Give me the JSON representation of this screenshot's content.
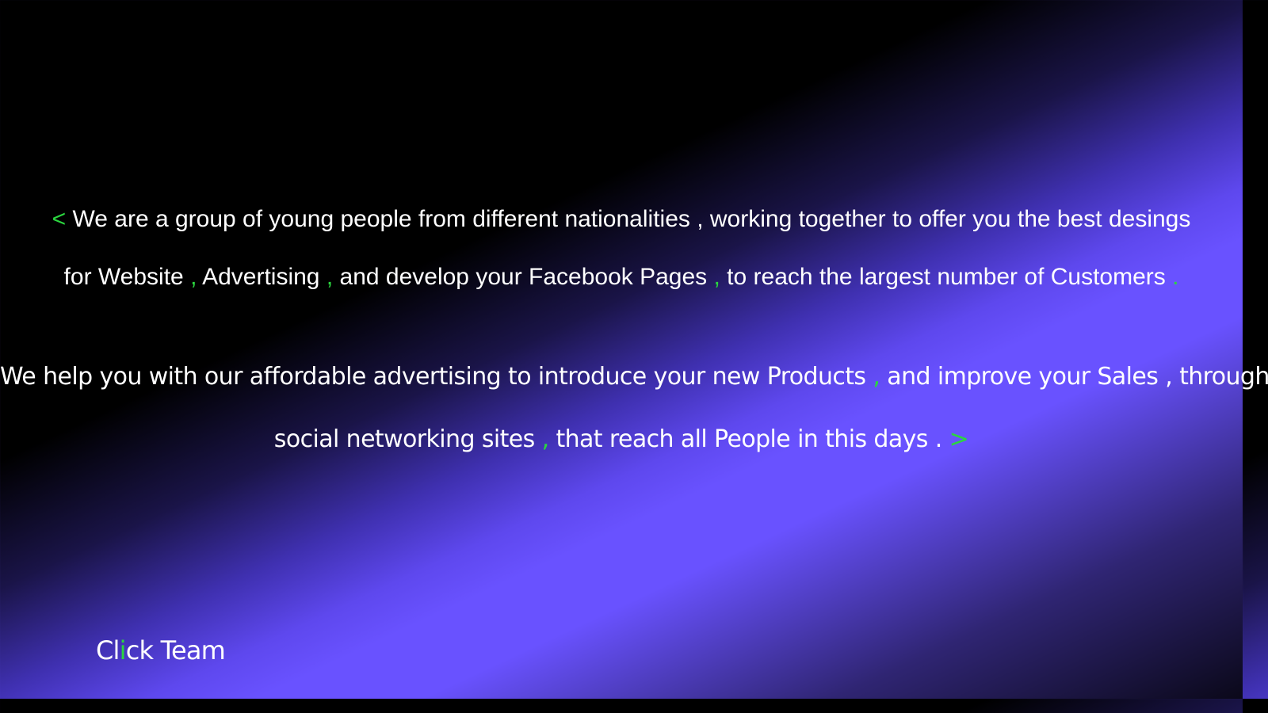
{
  "colors": {
    "accent": "#2bd63f",
    "text": "#ffffff",
    "gradient_dark": "#000000",
    "gradient_light": "#6952ff"
  },
  "intro": {
    "line1": {
      "open_bracket": "<",
      "text": " We are a group of young people from different nationalities , working together to offer you the best desings"
    },
    "line2": {
      "part1": "for Website ",
      "comma1": ",",
      "part2": " Advertising ",
      "comma2": ",",
      "part3": " and develop your Facebook Pages ",
      "comma3": ",",
      "part4": " to reach the largest number of Customers ",
      "period": "."
    }
  },
  "help": {
    "line1": {
      "part1": "We help you with our affordable advertising to introduce your new Products ",
      "comma": ",",
      "part2": " and improve your Sales , through"
    },
    "line2": {
      "part1": "social networking sites ",
      "comma": ",",
      "part2": "  that reach all People in this days . ",
      "close_bracket": ">"
    }
  },
  "brand": {
    "part1": "Cl",
    "accent_letter": "i",
    "part2": "ck Team"
  }
}
